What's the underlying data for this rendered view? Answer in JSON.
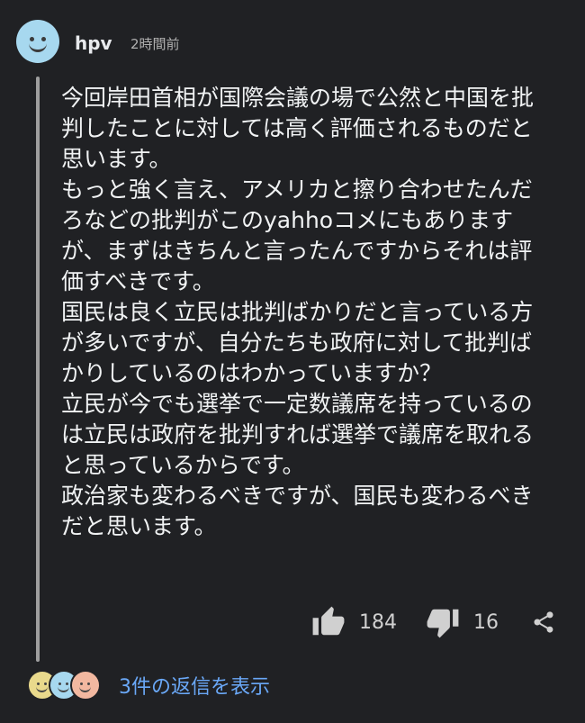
{
  "comment": {
    "author": "hpv",
    "timestamp": "2時間前",
    "lines": [
      "今回岸田首相が国際会議の場で公然と中国を批",
      "判したことに対しては高く評価されるものだと",
      "思います。",
      "もっと強く言え、アメリカと擦り合わせたんだ",
      "ろなどの批判がこのyahhoコメにもあります",
      "が、まずはきちんと言ったんですからそれは評",
      "価すべきです。",
      "国民は良く立民は批判ばかりだと言っている方",
      "が多いですが、自分たちも政府に対して批判ば",
      "かりしているのはわかっていますか？",
      "立民が今でも選挙で一定数議席を持っているの",
      "は立民は政府を批判すれば選挙で議席を取れる",
      "と思っているからです。",
      "政治家も変わるべきですが、国民も変わるべき",
      "だと思います。"
    ],
    "likes": "184",
    "dislikes": "16"
  },
  "icons": {
    "like": "thumbs-up-icon",
    "dislike": "thumbs-down-icon",
    "share": "share-icon"
  },
  "replies": {
    "link_text": "3件の返信を表示",
    "avatar_colors": [
      "#e9d98c",
      "#a7d8ef",
      "#f2b8a0"
    ]
  },
  "colors": {
    "background": "#202124",
    "link": "#6aa8f7",
    "thread_line": "#9e9e9e"
  }
}
